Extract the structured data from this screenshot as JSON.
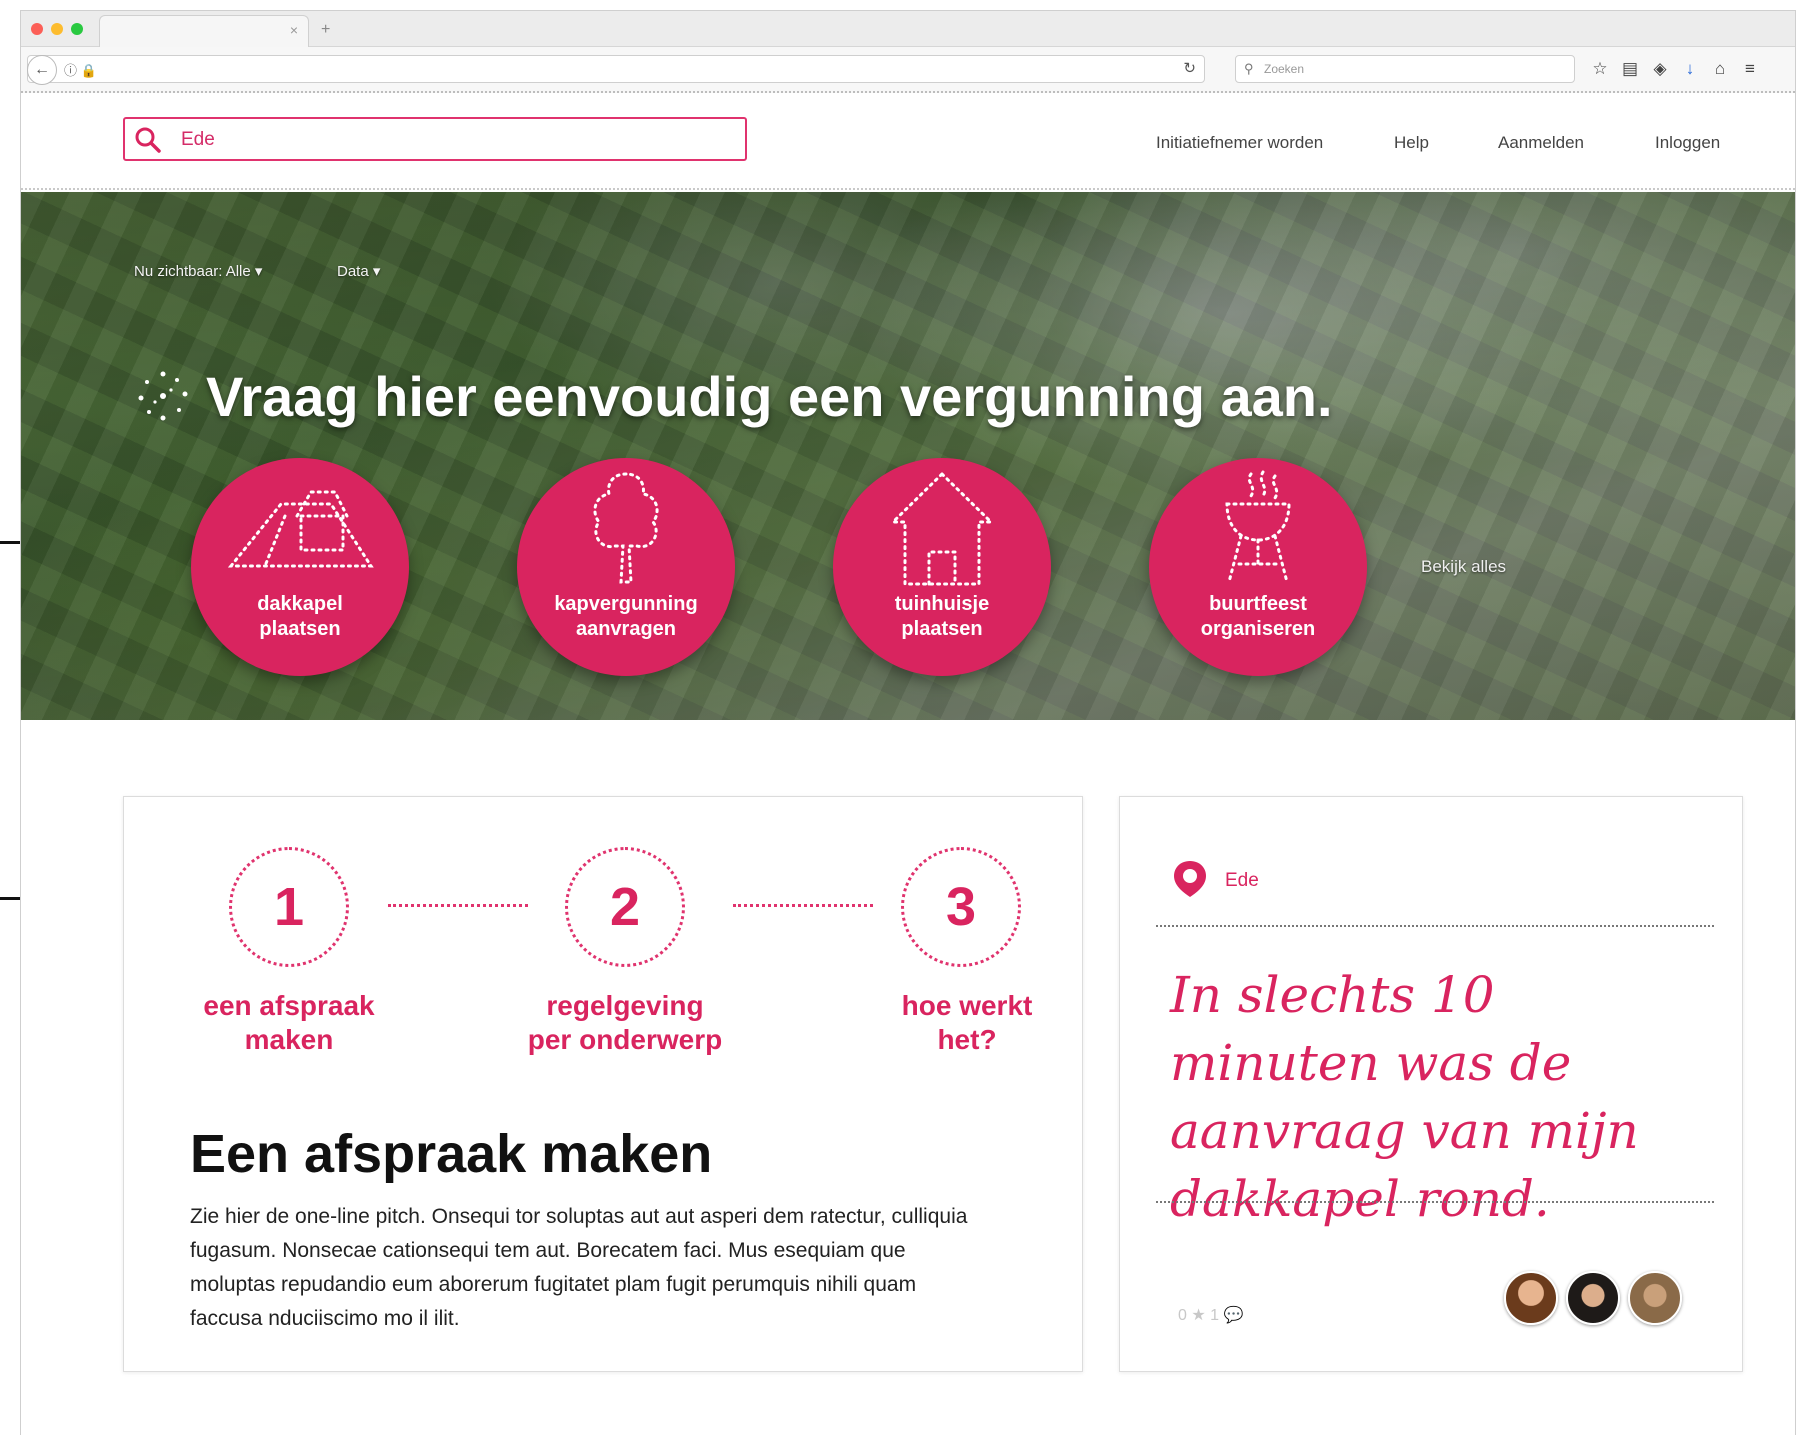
{
  "browser": {
    "search_placeholder": "Zoeken",
    "url_icons": "ⓘ 🔒"
  },
  "header": {
    "search_value": "Ede",
    "nav": [
      "Initiatiefnemer worden",
      "Help",
      "Aanmelden",
      "Inloggen"
    ]
  },
  "hero": {
    "filter_visible": "Nu zichtbaar: Alle ▾",
    "filter_data": "Data ▾",
    "title": "Vraag hier eenvoudig een vergunning aan.",
    "circles": [
      {
        "label_line1": "dakkapel",
        "label_line2": "plaatsen",
        "icon": "dormer-roof-icon"
      },
      {
        "label_line1": "kapvergunning",
        "label_line2": "aanvragen",
        "icon": "tree-icon"
      },
      {
        "label_line1": "tuinhuisje",
        "label_line2": "plaatsen",
        "icon": "house-icon"
      },
      {
        "label_line1": "buurtfeest",
        "label_line2": "organiseren",
        "icon": "barbecue-icon"
      }
    ],
    "view_all": "Bekijk alles"
  },
  "steps": [
    {
      "number": "1",
      "label_line1": "een afspraak",
      "label_line2": "maken"
    },
    {
      "number": "2",
      "label_line1": "regelgeving",
      "label_line2": "per onderwerp"
    },
    {
      "number": "3",
      "label_line1": "hoe werkt",
      "label_line2": "het?"
    }
  ],
  "section": {
    "title": "Een afspraak maken",
    "body": "Zie hier de one-line pitch. Onsequi tor soluptas aut aut asperi dem ratectur, culliquia fugasum. Nonsecae cationsequi tem aut. Borecatem faci. Mus esequiam que moluptas repudandio eum aborerum fugitatet plam fugit perumquis nihili quam faccusa nduciiscimo mo il ilit."
  },
  "testimonial": {
    "location": "Ede",
    "quote": "In slechts 10 minuten was de aanvraag van mijn dakkapel rond.",
    "meta": "0 ★ 1 💬"
  },
  "colors": {
    "accent": "#d9245f",
    "accent_border": "#e0336e"
  }
}
